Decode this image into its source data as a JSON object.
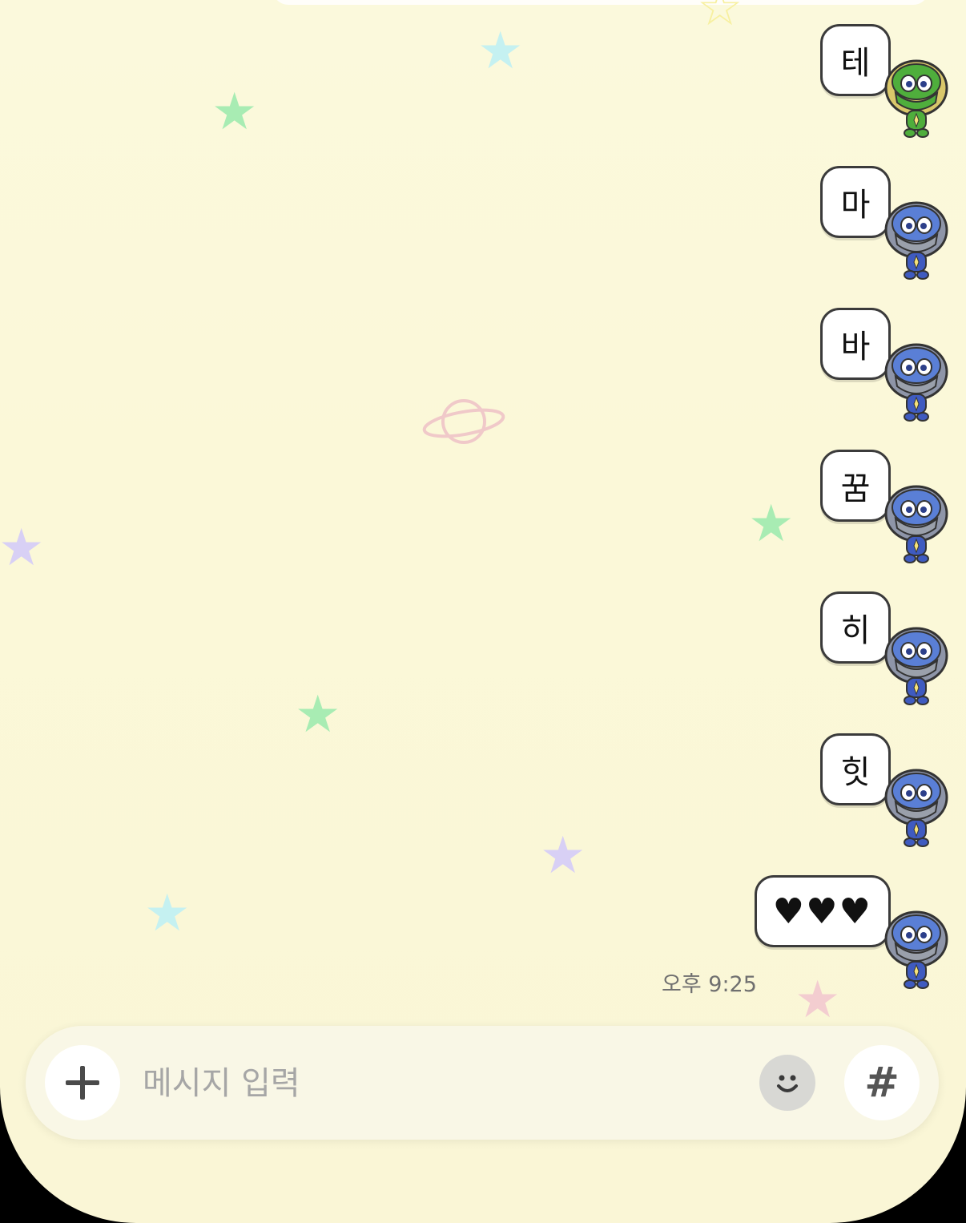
{
  "colors": {
    "background": "#fbf9dc",
    "bubble": "#ffffff",
    "bubble_border": "#3b3b3b",
    "star_green": "#a6ecb0",
    "star_blue": "#bfeff0",
    "star_purple": "#d7cff4",
    "star_pink": "#f3cccc",
    "planet": "#f0c8c8"
  },
  "messages": [
    {
      "text": "테",
      "avatar": "keroro-frog-avatar-icon"
    },
    {
      "text": "마",
      "avatar": "dororo-avatar-icon"
    },
    {
      "text": "바",
      "avatar": "dororo-avatar-icon"
    },
    {
      "text": "꿈",
      "avatar": "dororo-avatar-icon"
    },
    {
      "text": "히",
      "avatar": "dororo-avatar-icon"
    },
    {
      "text": "힛",
      "avatar": "dororo-avatar-icon"
    },
    {
      "text": "♥♥♥",
      "avatar": "dororo-avatar-icon"
    }
  ],
  "timestamp": "오후 9:25",
  "composer": {
    "placeholder": "메시지 입력",
    "plus_icon": "plus-icon",
    "emoji_icon": "smiley-icon",
    "hash_label": "#"
  },
  "decorations": {
    "stars": [
      "green",
      "blue",
      "purple",
      "pink",
      "yellow"
    ],
    "planet": "planet-icon"
  }
}
